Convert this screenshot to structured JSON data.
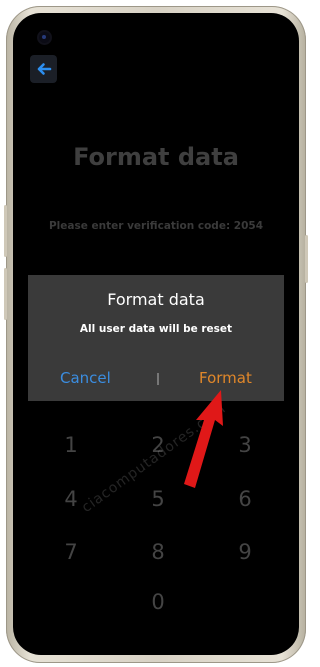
{
  "screen": {
    "page_title": "Format data",
    "verification_text": "Please enter verification code: 2054",
    "back_icon": "arrow-left-icon"
  },
  "dialog": {
    "title": "Format data",
    "message": "All user data will be reset",
    "cancel_label": "Cancel",
    "format_label": "Format",
    "cancel_color": "#3b8de0",
    "format_color": "#e0872a"
  },
  "keypad": {
    "keys": [
      "1",
      "2",
      "3",
      "4",
      "5",
      "6",
      "7",
      "8",
      "9",
      "0"
    ]
  },
  "annotation": {
    "arrow_color": "#e01818",
    "watermark": "ciacomputadores.com"
  }
}
